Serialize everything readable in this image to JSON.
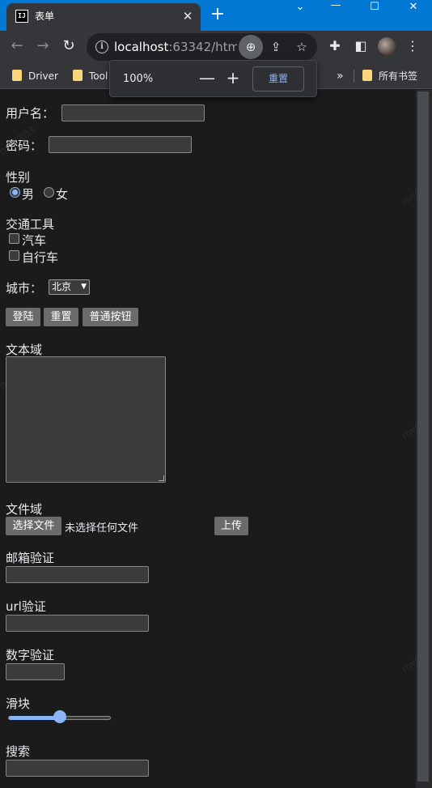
{
  "browser": {
    "tab_title": "表单",
    "tab_favicon_text": "IJ",
    "url_host": "localhost",
    "url_rest": ":63342/htm...",
    "zoom": {
      "level": "100%",
      "minus": "—",
      "plus": "+",
      "reset": "重置"
    },
    "bookmarks": [
      "Driver",
      "Tool",
      "所有书签"
    ],
    "bookmarks_overflow": "»"
  },
  "form": {
    "username_label": "用户名：",
    "password_label": "密码：",
    "gender_label": "性别",
    "gender_options": [
      "男",
      "女"
    ],
    "gender_selected": "男",
    "transport_label": "交通工具",
    "transport_options": [
      "汽车",
      "自行车"
    ],
    "city_label": "城市：",
    "city_selected": "北京",
    "buttons": {
      "submit": "登陆",
      "reset": "重置",
      "normal": "普通按钮"
    },
    "textarea_label": "文本域",
    "file_label": "文件域",
    "file_button": "选择文件",
    "file_status": "未选择任何文件",
    "upload_button": "上传",
    "email_label": "邮箱验证",
    "url_label": "url验证",
    "number_label": "数字验证",
    "range_label": "滑块",
    "range_value_fraction": 0.5,
    "search_label": "搜索"
  },
  "colors": {
    "titlebar": "#0078d4",
    "accent": "#8ab4f8",
    "page_bg": "#1b1b1c"
  }
}
